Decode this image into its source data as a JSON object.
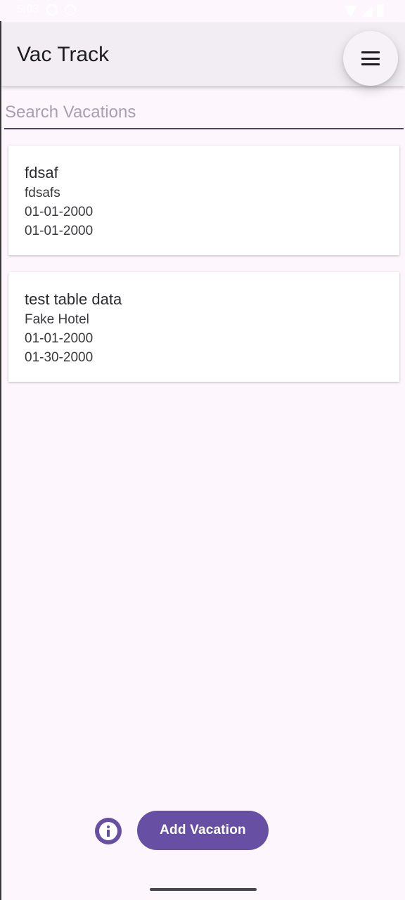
{
  "status_bar": {
    "time": "5:03"
  },
  "app_bar": {
    "title": "Vac Track",
    "menu_icon": "hamburger-menu-icon"
  },
  "search": {
    "placeholder": "Search Vacations",
    "value": ""
  },
  "vacations": [
    {
      "title": "fdsaf",
      "hotel": "fdsafs",
      "start_date": "01-01-2000",
      "end_date": "01-01-2000"
    },
    {
      "title": "test table data",
      "hotel": "Fake Hotel",
      "start_date": "01-01-2000",
      "end_date": "01-30-2000"
    }
  ],
  "actions": {
    "info_icon": "info-icon",
    "add_label": "Add Vacation"
  },
  "colors": {
    "primary": "#6750a4",
    "background": "#fdf7fd",
    "app_bar": "#f1edf3"
  }
}
